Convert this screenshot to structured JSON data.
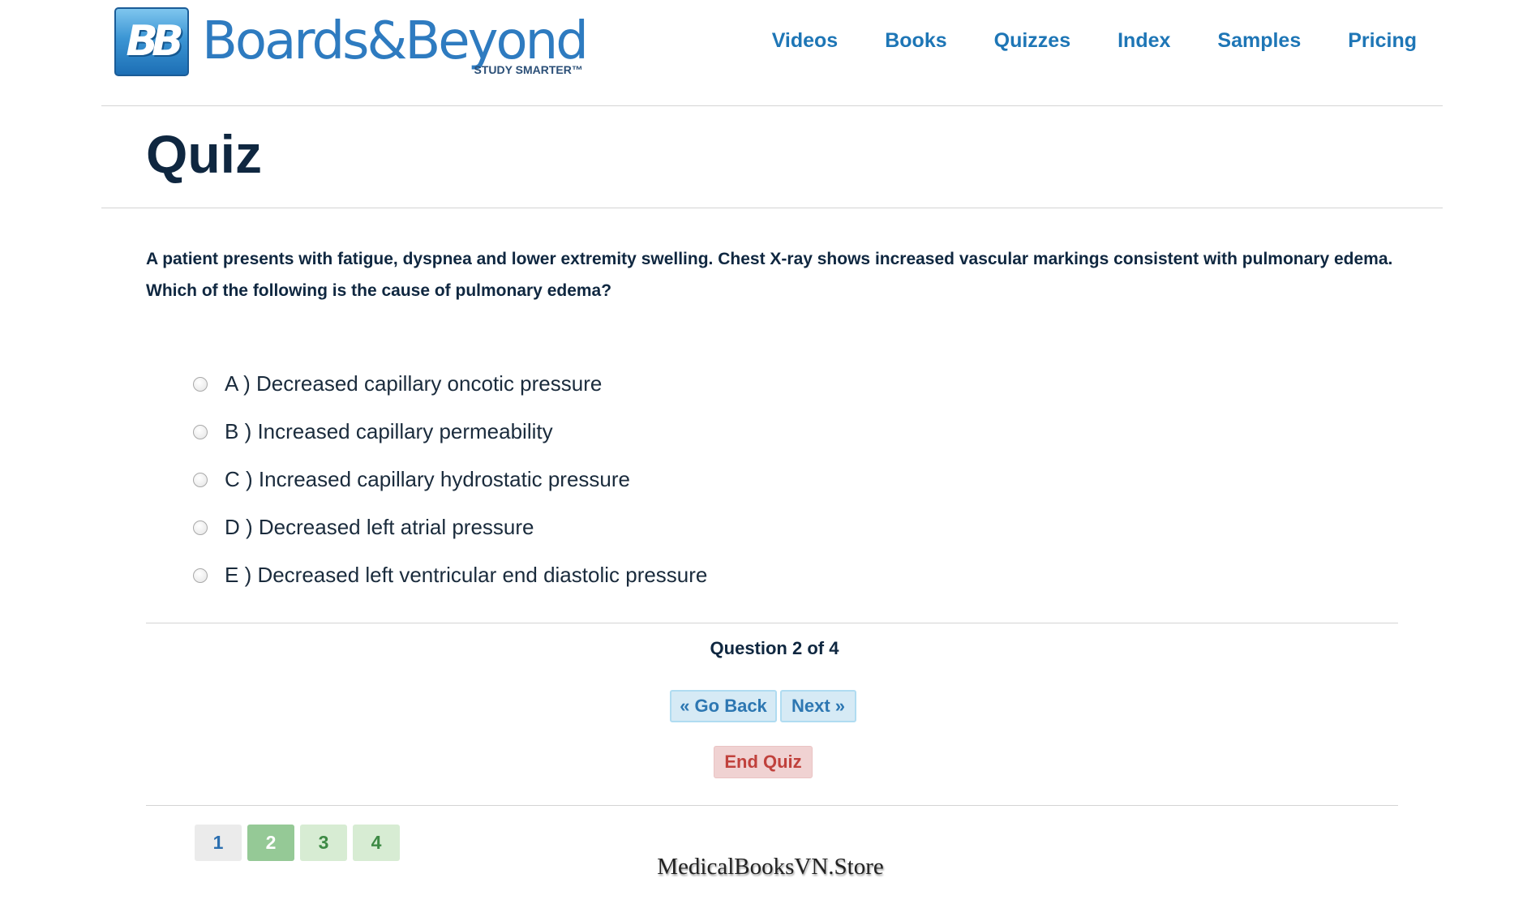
{
  "brand": {
    "badge": "BB",
    "name": "Boards&Beyond",
    "tagline": "STUDY SMARTER™"
  },
  "nav": [
    {
      "label": "Videos"
    },
    {
      "label": "Books"
    },
    {
      "label": "Quizzes"
    },
    {
      "label": "Index"
    },
    {
      "label": "Samples"
    },
    {
      "label": "Pricing"
    }
  ],
  "page": {
    "title": "Quiz"
  },
  "quiz": {
    "question": "A patient presents with fatigue, dyspnea and lower extremity swelling. Chest X-ray shows increased vascular markings consistent with pulmonary edema. Which of the following is the cause of pulmonary edema?",
    "options": [
      {
        "label": "A ) Decreased capillary oncotic pressure"
      },
      {
        "label": "B ) Increased capillary permeability"
      },
      {
        "label": "C ) Increased capillary hydrostatic pressure"
      },
      {
        "label": "D ) Decreased left atrial pressure"
      },
      {
        "label": "E ) Decreased left ventricular end diastolic pressure"
      }
    ],
    "progress": "Question 2 of 4",
    "back_label": "« Go Back",
    "next_label": "Next »",
    "end_label": "End Quiz",
    "pages": [
      {
        "label": "1",
        "state": "default"
      },
      {
        "label": "2",
        "state": "current"
      },
      {
        "label": "3",
        "state": "answered"
      },
      {
        "label": "4",
        "state": "answered"
      }
    ]
  },
  "watermark": "MedicalBooksVN.Store",
  "colors": {
    "heading": "#0f2740",
    "nav_link": "#1e76b6",
    "brand_blue": "#2e7bc0",
    "button_blue_bg": "#d6eaf5",
    "button_red_text": "#c0413c",
    "page_current": "#95c996"
  }
}
